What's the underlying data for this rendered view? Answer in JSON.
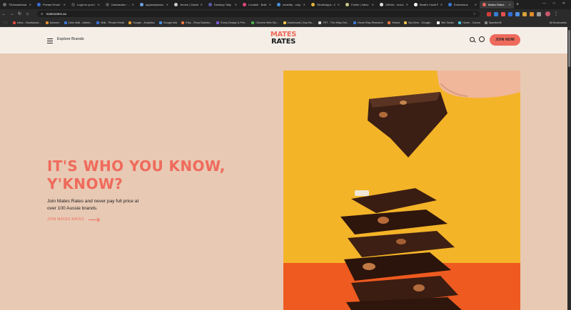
{
  "browser": {
    "tabs": [
      {
        "title": "TEAmsaldoral | ...",
        "color": "#6b6b6b"
      },
      {
        "title": "Private Email · ...",
        "color": "#3b6fd8"
      },
      {
        "title": "Login to your I...",
        "color": "#4a4a4a"
      },
      {
        "title": "Dantasuton · ...",
        "color": "#555555"
      },
      {
        "title": "apparatpicsse...",
        "color": "#6fa0e0"
      },
      {
        "title": "Jeroen | Dashb...",
        "color": "#cccccc"
      },
      {
        "title": "Desktop Tally",
        "color": "#5a5aaa"
      },
      {
        "title": "Lovable · Built...",
        "color": "#e2497c"
      },
      {
        "title": "smartify - only ...",
        "color": "#4a90e2"
      },
      {
        "title": "SleuthApps - D...",
        "color": "#e6b43a"
      },
      {
        "title": "Foster | Inbox",
        "color": "#c9c98a"
      },
      {
        "title": "GitHub - mont...",
        "color": "#dddddd"
      },
      {
        "title": "Beatt's Yacht Re...",
        "color": "#ffffff"
      },
      {
        "title": "Extensions",
        "color": "#3a7bd5"
      },
      {
        "title": "Mates Rates",
        "color": "#ee6a5b"
      }
    ],
    "active_tab_index": 14,
    "new_tab_label": "+",
    "url": "matesrates.au",
    "extension_colors": [
      "#d33b3b",
      "#3a7bd5",
      "#e55050",
      "#2f6fdb",
      "#4e8fe0",
      "#d7a23a",
      "#e08a2e",
      "#9a9a9a"
    ],
    "bookmarks": [
      {
        "label": "Inbox - Bootsdoub...",
        "color": "#e0493a"
      },
      {
        "label": "Amazon",
        "color": "#e08a2e"
      },
      {
        "label": "Zoho Mail - Admin...",
        "color": "#3a7bd5"
      },
      {
        "label": "Mail - Private Email",
        "color": "#3b6fd8"
      },
      {
        "label": "Google - Analytics",
        "color": "#e59a2b"
      },
      {
        "label": "Google Ads",
        "color": "#4a90e2"
      },
      {
        "label": "Etsy - Shop Dashbo...",
        "color": "#e8743b"
      },
      {
        "label": "Every Design & Prin...",
        "color": "#7a5ad8"
      },
      {
        "label": "Chrome Web Sto...",
        "color": "#4caf50"
      },
      {
        "label": "Dashboard | Buy Mo...",
        "color": "#f2c24b"
      },
      {
        "label": "TET - The eBay Dst...",
        "color": "#d8d8d8"
      },
      {
        "label": "Home Etsy Research",
        "color": "#3a7bd5"
      },
      {
        "label": "Yesbot",
        "color": "#e8743b"
      },
      {
        "label": "My Drive - Google...",
        "color": "#f2c24b"
      },
      {
        "label": "Wix Studio",
        "color": "#ffffff"
      },
      {
        "label": "Home - Canva",
        "color": "#4ac0d8"
      },
      {
        "label": "SparkleLift",
        "color": "#888888"
      }
    ],
    "all_bookmarks_label": "All Bookmarks"
  },
  "site": {
    "explore_label": "Explore Brands",
    "logo_line1": "MATES",
    "logo_line2": "RATES",
    "join_button": "JOIN NOW",
    "hero_title_line1": "IT'S WHO YOU KNOW,",
    "hero_title_line2": "Y'KNOW?",
    "hero_subtitle": "Join Mates Rates and never pay full price at over 100 Aussie brands.",
    "hero_link": "JOIN MATES RATES",
    "brand_color": "#ee6a5b",
    "hero_image_bg": "#f4b428"
  }
}
